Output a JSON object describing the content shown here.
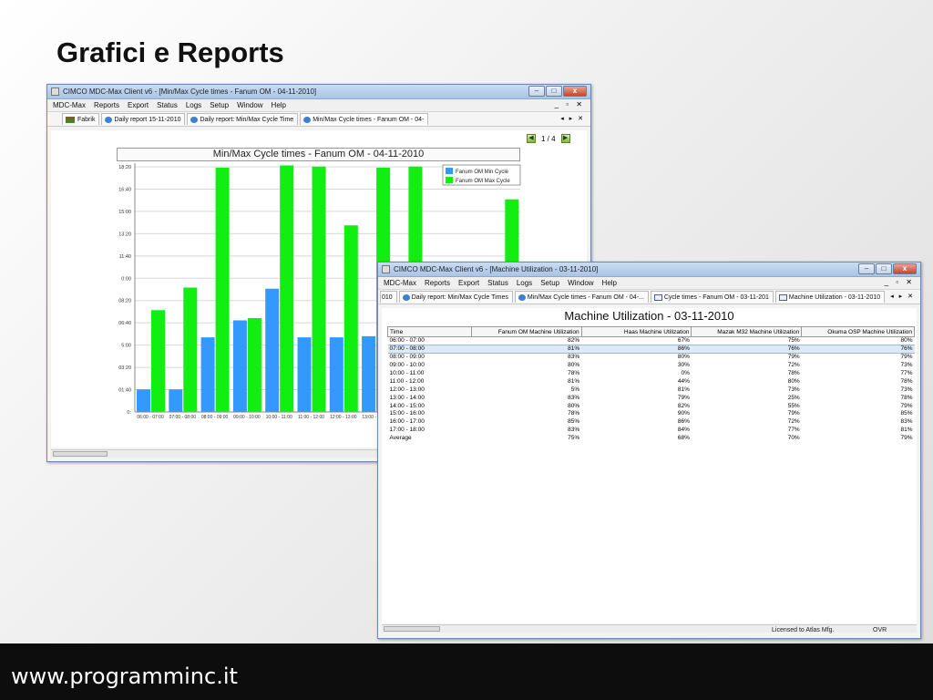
{
  "slide": {
    "title": "Grafici e Reports",
    "footer": "www.programminc.it"
  },
  "win1": {
    "title": "CIMCO MDC-Max Client v6 - [Min/Max Cycle times - Fanum OM - 04-11-2010]",
    "menu": [
      "MDC-Max",
      "Reports",
      "Export",
      "Status",
      "Logs",
      "Setup",
      "Window",
      "Help"
    ],
    "mdi_controls": "_ ▫ ✕",
    "tabs": [
      "Fabrik",
      "Daily report 15-11-2010",
      "Daily report: Min/Max Cycle Time",
      "Min/Max Cycle times - Fanum OM - 04-"
    ],
    "tab_nav": "◂ ▸ ✕",
    "pager": "1 / 4"
  },
  "win2": {
    "title": "CIMCO MDC-Max Client v6 - [Machine Utilization - 03-11-2010]",
    "menu": [
      "MDC-Max",
      "Reports",
      "Export",
      "Status",
      "Logs",
      "Setup",
      "Window",
      "Help"
    ],
    "mdi_controls": "_ ▫ ✕",
    "tabs": [
      "010",
      "Daily report: Min/Max Cycle Times",
      "Min/Max Cycle times - Fanum OM - 04-...",
      "Cycle times - Fanum OM - 03-11-201",
      "Machine Utilization - 03-11-2010"
    ],
    "tab_nav": "◂ ▸ ✕",
    "report_title": "Machine Utilization - 03-11-2010",
    "columns": [
      "Time",
      "Fanum OM Machine Utilization",
      "Haas Machine Utilization",
      "Mazak M32 Machine Utilization",
      "Okuma OSP Machine Utilization"
    ],
    "rows": [
      [
        "06:00 - 07:00",
        "82%",
        "67%",
        "75%",
        "80%"
      ],
      [
        "07:00 - 08:00",
        "81%",
        "86%",
        "76%",
        "76%"
      ],
      [
        "08:00 - 09:00",
        "83%",
        "80%",
        "79%",
        "79%"
      ],
      [
        "09:00 - 10:00",
        "80%",
        "30%",
        "72%",
        "73%"
      ],
      [
        "10:00 - 11:00",
        "78%",
        "0%",
        "78%",
        "77%"
      ],
      [
        "11:00 - 12:00",
        "81%",
        "44%",
        "80%",
        "78%"
      ],
      [
        "12:00 - 13:00",
        "5%",
        "81%",
        "73%",
        "73%"
      ],
      [
        "13:00 - 14:00",
        "83%",
        "79%",
        "25%",
        "78%"
      ],
      [
        "14:00 - 15:00",
        "80%",
        "82%",
        "55%",
        "79%"
      ],
      [
        "15:00 - 16:00",
        "78%",
        "90%",
        "79%",
        "85%"
      ],
      [
        "16:00 - 17:00",
        "85%",
        "86%",
        "72%",
        "83%"
      ],
      [
        "17:00 - 18:00",
        "83%",
        "84%",
        "77%",
        "81%"
      ],
      [
        "Average",
        "75%",
        "68%",
        "70%",
        "79%"
      ]
    ],
    "selected_row": 1,
    "status_license": "Licensed to Atlas Mfg.",
    "status_mode": "OVR"
  },
  "chart_data": {
    "type": "bar",
    "title": "Min/Max Cycle times - Fanum OM - 04-11-2010",
    "yticks": [
      "0:",
      "01:40",
      "03:20",
      "5:00",
      "06:40",
      "08:20",
      "0:00",
      "11:40",
      "13:20",
      "15:00",
      "16:40",
      "18:20"
    ],
    "ylim_minutes": [
      0,
      1100
    ],
    "categories": [
      "06:00 - 07:00",
      "07:00 - 08:00",
      "08:00 - 09:00",
      "09:00 - 10:00",
      "10:00 - 11:00",
      "11:00 - 12:00",
      "12:00 - 13:00",
      "13:00 - 14:00",
      "14:00 - 15:00",
      "15:00 - 16:00",
      "16:00 - 17:00",
      "17:00 - 18:00"
    ],
    "series": [
      {
        "name": "Fanum OM Min Cycle",
        "color": "#3399ff",
        "values": [
          100,
          100,
          330,
          405,
          545,
          330,
          330,
          335,
          null,
          null,
          null,
          null
        ]
      },
      {
        "name": "Fanum OM Max Cycle",
        "color": "#11ee11",
        "values": [
          450,
          550,
          1080,
          415,
          1090,
          1085,
          825,
          1080,
          1085,
          null,
          null,
          940
        ]
      }
    ],
    "legend_position": "top-right"
  }
}
